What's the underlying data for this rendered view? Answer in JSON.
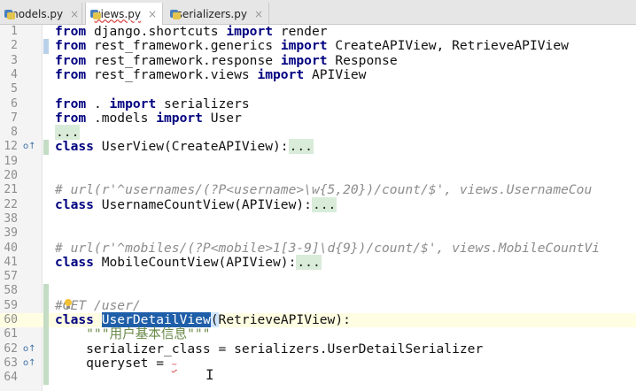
{
  "tabs": [
    {
      "label": "models.py",
      "active": false,
      "error": false
    },
    {
      "label": "views.py",
      "active": true,
      "error": true
    },
    {
      "label": "serializers.py",
      "active": false,
      "error": false
    }
  ],
  "tab_close_glyph": "×",
  "editor": {
    "lines": [
      {
        "num": "1",
        "text": "from django.shortcuts import render"
      },
      {
        "num": "2",
        "text": "from rest_framework.generics import CreateAPIView, RetrieveAPIView"
      },
      {
        "num": "3",
        "text": "from rest_framework.response import Response"
      },
      {
        "num": "4",
        "text": "from rest_framework.views import APIView"
      },
      {
        "num": "5",
        "text": ""
      },
      {
        "num": "6",
        "text": "from . import serializers"
      },
      {
        "num": "7",
        "text": "from .models import User"
      },
      {
        "num": "8",
        "text": "..."
      },
      {
        "num": "12",
        "text": "class UserView(CreateAPIView):..."
      },
      {
        "num": "19",
        "text": ""
      },
      {
        "num": "20",
        "text": ""
      },
      {
        "num": "21",
        "text": "# url(r'^usernames/(?P<username>\\w{5,20})/count/$', views.UsernameCou"
      },
      {
        "num": "22",
        "text": "class UsernameCountView(APIView):..."
      },
      {
        "num": "38",
        "text": ""
      },
      {
        "num": "39",
        "text": ""
      },
      {
        "num": "40",
        "text": "# url(r'^mobiles/(?P<mobile>1[3-9]\\d{9})/count/$', views.MobileCountVi"
      },
      {
        "num": "41",
        "text": "class MobileCountView(APIView):..."
      },
      {
        "num": "57",
        "text": ""
      },
      {
        "num": "58",
        "text": ""
      },
      {
        "num": "59",
        "text": "#GET /user/"
      },
      {
        "num": "60",
        "text": "class UserDetailView(RetrieveAPIView):"
      },
      {
        "num": "61",
        "text": "    \"\"\"用户基本信息\"\"\""
      },
      {
        "num": "62",
        "text": "    serializer_class = serializers.UserDetailSerializer"
      },
      {
        "num": "63",
        "text": "    queryset ="
      },
      {
        "num": "64",
        "text": ""
      }
    ]
  },
  "code_tokens": {
    "l1": [
      "from",
      " django.shortcuts ",
      "import",
      " render"
    ],
    "l2": [
      "from",
      " rest_framework.generics ",
      "import",
      " CreateAPIView, RetrieveAPIView"
    ],
    "l3": [
      "from",
      " rest_framework.response ",
      "import",
      " Response"
    ],
    "l4": [
      "from",
      " rest_framework.views ",
      "import",
      " APIView"
    ],
    "l6": [
      "from",
      " . ",
      "import",
      " serializers"
    ],
    "l7": [
      "from",
      " .models ",
      "import",
      " User"
    ],
    "l8": [
      "..."
    ],
    "l12": [
      "class",
      " UserView(CreateAPIView):",
      "..."
    ],
    "l21": [
      "# url(r'^usernames/(?P<username>\\w{5,20})/count/$', views.UsernameCou"
    ],
    "l22": [
      "class",
      " UsernameCountView(APIView):",
      "..."
    ],
    "l40": [
      "# url(r'^mobiles/(?P<mobile>1[3-9]\\d{9})/count/$', views.MobileCountVi"
    ],
    "l41": [
      "class",
      " MobileCountView(APIView):",
      "..."
    ],
    "l59": [
      "#GET /user/"
    ],
    "l60": [
      "class",
      " ",
      "UserDetailView",
      "(",
      "RetrieveAPIView):"
    ],
    "l61": [
      "    \"\"\"用户基本信息\"\"\""
    ],
    "l62": [
      "    serializer_class = serializers.UserDetailSerializer"
    ],
    "l63": [
      "    queryset = ",
      "~"
    ]
  },
  "gutter_marks": {
    "l12": "o↑",
    "l22": "",
    "l41": "",
    "l62": "o↑",
    "l63": "o↑"
  },
  "colors": {
    "keyword": "#000080",
    "comment": "#8c8c8c",
    "selection": "#1f5ea8",
    "current_line": "#fffde2",
    "vcs_added": "#c3dcc3"
  },
  "icons": {
    "file": "python-file-icon",
    "bulb": "intention-bulb-icon",
    "cursor": "text-cursor-icon",
    "override": "override-gutter-icon"
  },
  "cursor_glyph": "I"
}
